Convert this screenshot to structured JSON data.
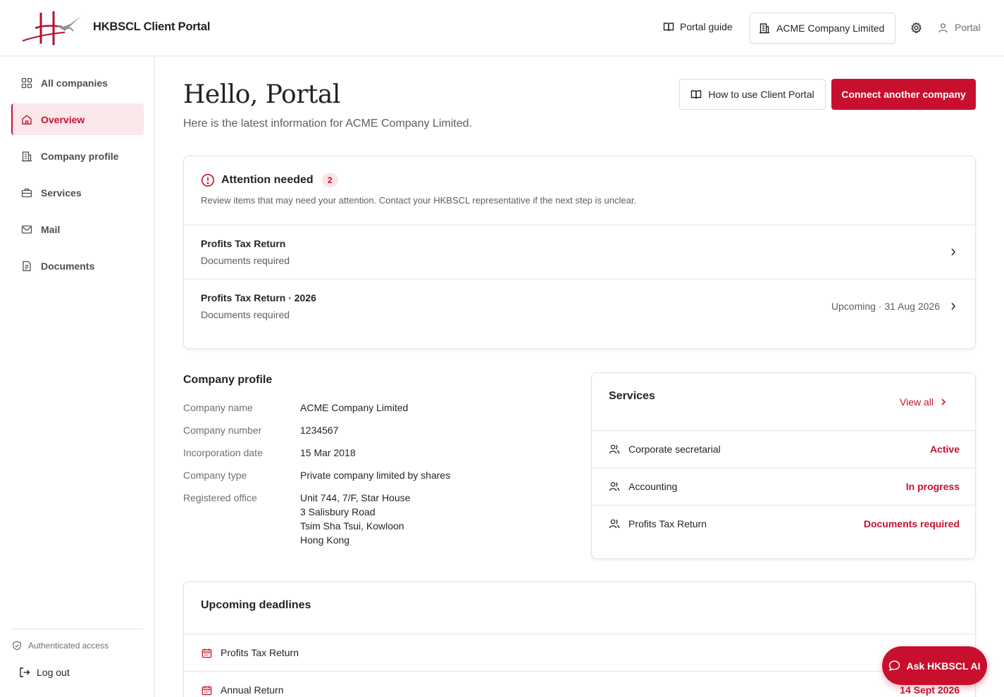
{
  "header": {
    "brand": "HKBSCL Client Portal",
    "portal_guide": "Portal guide",
    "company_switcher": "ACME Company Limited",
    "user": "Portal"
  },
  "sidebar": {
    "items": [
      {
        "label": "All companies",
        "icon": "grid-icon"
      },
      {
        "label": "Overview",
        "icon": "home-icon",
        "active": true
      },
      {
        "label": "Company profile",
        "icon": "building-icon"
      },
      {
        "label": "Services",
        "icon": "briefcase-icon"
      },
      {
        "label": "Mail",
        "icon": "mail-icon"
      },
      {
        "label": "Documents",
        "icon": "document-icon"
      }
    ],
    "auth_label": "Authenticated access",
    "logout_label": "Log out"
  },
  "main": {
    "greeting": "Hello, Portal",
    "subtitle": "Here is the latest information for ACME Company Limited.",
    "howto_button": "How to use Client Portal",
    "connect_button": "Connect another company"
  },
  "attention": {
    "title": "Attention needed",
    "count": "2",
    "description": "Review items that may need your attention. Contact your HKBSCL representative if the next step is unclear.",
    "items": [
      {
        "title": "Profits Tax Return",
        "subtitle": "Documents required",
        "meta": ""
      },
      {
        "title": "Profits Tax Return · 2026",
        "subtitle": "Documents required",
        "meta": "Upcoming · 31 Aug 2026"
      }
    ]
  },
  "company_profile": {
    "title": "Company profile",
    "fields": [
      {
        "label": "Company name",
        "value": "ACME Company Limited"
      },
      {
        "label": "Company number",
        "value": "1234567"
      },
      {
        "label": "Incorporation date",
        "value": "15 Mar 2018"
      },
      {
        "label": "Company type",
        "value": "Private company limited by shares"
      }
    ],
    "registered_office": {
      "label": "Registered office",
      "lines": [
        "Unit 744, 7/F, Star House",
        "3 Salisbury Road",
        "Tsim Sha Tsui, Kowloon",
        "Hong Kong"
      ]
    }
  },
  "services": {
    "title": "Services",
    "view_all": "View all",
    "items": [
      {
        "name": "Corporate secretarial",
        "status": "Active"
      },
      {
        "name": "Accounting",
        "status": "In progress"
      },
      {
        "name": "Profits Tax Return",
        "status": "Documents required"
      }
    ]
  },
  "deadlines": {
    "title": "Upcoming deadlines",
    "items": [
      {
        "name": "Profits Tax Return",
        "date": ""
      },
      {
        "name": "Annual Return",
        "date": "14 Sept 2026"
      }
    ]
  },
  "ask_ai": "Ask HKBSCL AI",
  "colors": {
    "accent": "#c8102e",
    "accent_bg": "#fbe8ea"
  }
}
